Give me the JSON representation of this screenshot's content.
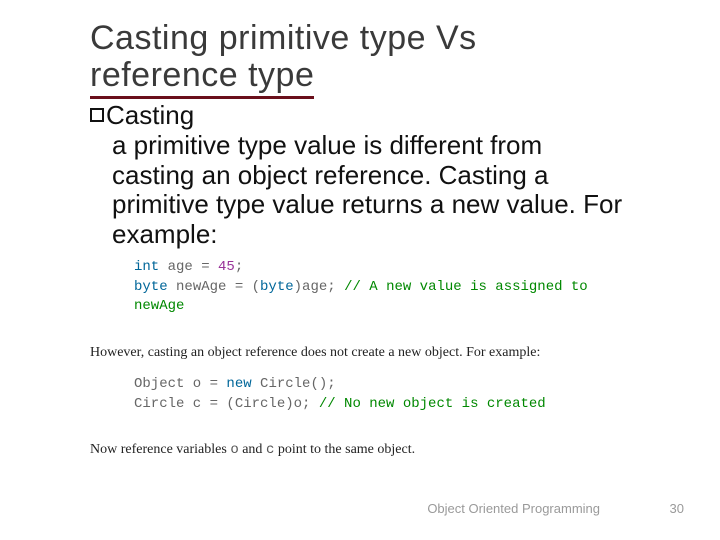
{
  "title_line1": "Casting primitive type Vs",
  "title_line2": "reference type",
  "bullet_first_word": "Casting",
  "bullet_rest": " a primitive type value is different from casting an object reference. Casting a primitive type value returns a new value. For example:",
  "code1": {
    "l1_kw": "int",
    "l1_rest": " age = ",
    "l1_num": "45",
    "l1_end": ";",
    "l2_kw": "byte",
    "l2_rest": " newAge = (",
    "l2_cast_kw": "byte",
    "l2_rest2": ")age; ",
    "l2_cmt": "// A new value is assigned to newAge"
  },
  "prose1_a": "However, casting an object reference does not create a new object. For example:",
  "code2": {
    "l1_a": "Object o = ",
    "l1_kw": "new",
    "l1_b": " Circle();",
    "l2_a": "Circle c = (Circle)o; ",
    "l2_cmt": "// No new object is created"
  },
  "prose2_a": "Now reference variables ",
  "prose2_var1": "o",
  "prose2_b": " and ",
  "prose2_var2": "c",
  "prose2_c": " point to the same object.",
  "footer_label": "Object Oriented Programming",
  "footer_num": "30"
}
